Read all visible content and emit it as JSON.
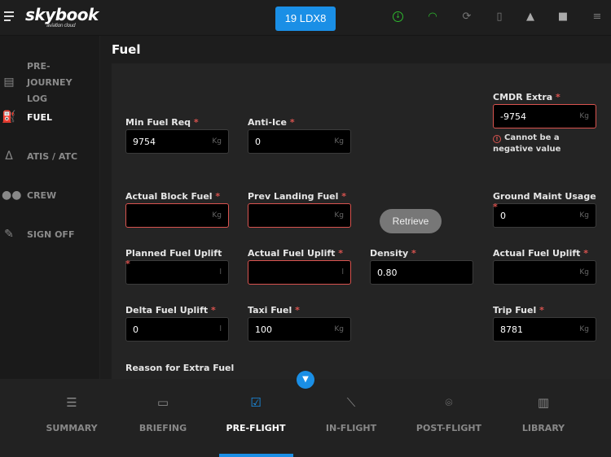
{
  "header": {
    "logo": "skybook",
    "logo_sub": "aviation cloud",
    "flight": "19 LDX8"
  },
  "sidebar": {
    "items": [
      {
        "label": "PRE-JOURNEY LOG"
      },
      {
        "label": "FUEL"
      },
      {
        "label": "ATIS / ATC"
      },
      {
        "label": "CREW"
      },
      {
        "label": "SIGN OFF"
      }
    ]
  },
  "page": {
    "title": "Fuel"
  },
  "fields": {
    "min_fuel_req": {
      "label": "Min Fuel Req",
      "value": "9754",
      "unit": "Kg"
    },
    "anti_ice": {
      "label": "Anti-Ice",
      "value": "0",
      "unit": "Kg"
    },
    "cmdr_extra": {
      "label": "CMDR Extra",
      "value": "-9754",
      "unit": "Kg",
      "error": "Cannot be a negative value"
    },
    "actual_block_fuel": {
      "label": "Actual Block Fuel",
      "value": "",
      "unit": "Kg"
    },
    "prev_landing_fuel": {
      "label": "Prev Landing Fuel",
      "value": "",
      "unit": "Kg"
    },
    "ground_maint_usage": {
      "label": "Ground Maint Usage",
      "value": "0",
      "unit": "Kg"
    },
    "planned_fuel_uplift": {
      "label": "Planned Fuel Uplift",
      "value": "",
      "unit": "l"
    },
    "actual_fuel_uplift_l": {
      "label": "Actual Fuel Uplift",
      "value": "",
      "unit": "l"
    },
    "density": {
      "label": "Density",
      "value": "0.80"
    },
    "actual_fuel_uplift_kg": {
      "label": "Actual Fuel Uplift",
      "value": "",
      "unit": "Kg"
    },
    "delta_fuel_uplift": {
      "label": "Delta Fuel Uplift",
      "value": "0",
      "unit": "l"
    },
    "taxi_fuel": {
      "label": "Taxi Fuel",
      "value": "100",
      "unit": "Kg"
    },
    "trip_fuel": {
      "label": "Trip Fuel",
      "value": "8781",
      "unit": "Kg"
    }
  },
  "required_mark": "*",
  "retrieve_label": "Retrieve",
  "reason_label": "Reason for Extra Fuel",
  "tabs": [
    {
      "label": "SUMMARY"
    },
    {
      "label": "BRIEFING"
    },
    {
      "label": "PRE-FLIGHT"
    },
    {
      "label": "IN-FLIGHT"
    },
    {
      "label": "POST-FLIGHT"
    },
    {
      "label": "LIBRARY"
    }
  ],
  "colors": {
    "accent": "#1a8fe6",
    "error": "#d9534f",
    "online": "#2eb82e"
  }
}
